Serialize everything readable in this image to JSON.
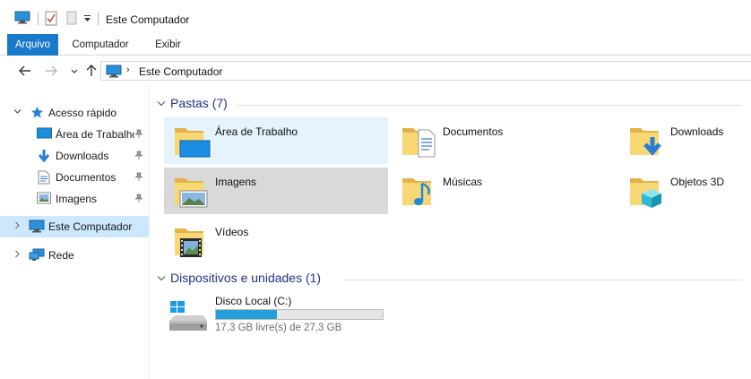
{
  "window": {
    "title": "Este Computador"
  },
  "ribbon": {
    "tabs": [
      "Arquivo",
      "Computador",
      "Exibir"
    ]
  },
  "address": {
    "location": "Este Computador"
  },
  "navpane": {
    "quick_access": "Acesso rápido",
    "quick_items": [
      {
        "label": "Área de Trabalho",
        "icon": "desktop-icon"
      },
      {
        "label": "Downloads",
        "icon": "download-icon"
      },
      {
        "label": "Documentos",
        "icon": "documents-icon"
      },
      {
        "label": "Imagens",
        "icon": "pictures-icon"
      }
    ],
    "this_pc": "Este Computador",
    "network": "Rede"
  },
  "folders": {
    "header": "Pastas (7)",
    "items": [
      {
        "label": "Área de Trabalho",
        "icon": "desktop-folder-icon"
      },
      {
        "label": "Documentos",
        "icon": "documents-folder-icon"
      },
      {
        "label": "Downloads",
        "icon": "downloads-folder-icon"
      },
      {
        "label": "Imagens",
        "icon": "pictures-folder-icon"
      },
      {
        "label": "Músicas",
        "icon": "music-folder-icon"
      },
      {
        "label": "Objetos 3D",
        "icon": "3d-objects-folder-icon"
      },
      {
        "label": "Vídeos",
        "icon": "videos-folder-icon"
      }
    ]
  },
  "devices": {
    "header": "Dispositivos e unidades (1)",
    "drive": {
      "name": "Disco Local (C:)",
      "free_text": "17,3 GB livre(s) de 27,3 GB",
      "used_fraction": 0.366
    }
  },
  "colors": {
    "accent": "#1979ca",
    "selection": "#cce8ff",
    "hover": "#e5f3ff",
    "drive_bar": "#26a0da",
    "group_title": "#1e3287"
  }
}
